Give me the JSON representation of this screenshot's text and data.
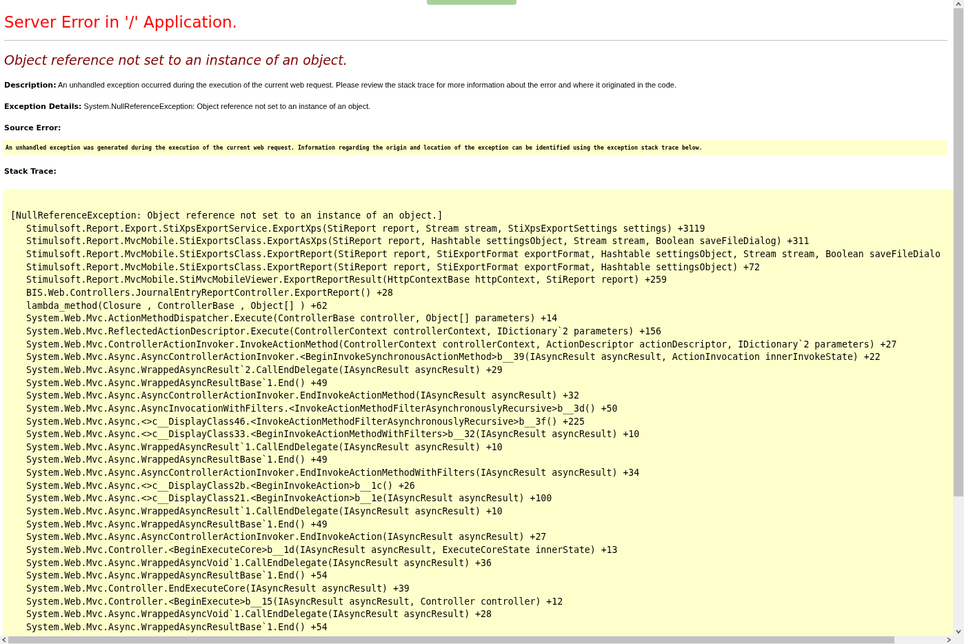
{
  "title": "Server Error in '/' Application.",
  "error_message": "Object reference not set to an instance of an object.",
  "description": "**Description:** An unhandled exception occurred during the execution of the current web request. Please review the stack trace for more information about the error and where it originated in the code.",
  "exception_details": "**Exception Details:** System.NullReferenceException: Object reference not set to an instance of an object.",
  "source_error": {
    "label": "Source Error:",
    "text": "An unhandled exception was generated during the execution of the current web request. Information regarding the origin and location of the exception can be identified using the exception stack trace below."
  },
  "stack_trace": {
    "label": "Stack Trace:",
    "header": "[NullReferenceException: Object reference not set to an instance of an object.]",
    "frames": [
      "Stimulsoft.Report.Export.StiXpsExportService.ExportXps(StiReport report, Stream stream, StiXpsExportSettings settings) +3119",
      "Stimulsoft.Report.MvcMobile.StiExportsClass.ExportAsXps(StiReport report, Hashtable settingsObject, Stream stream, Boolean saveFileDialog) +311",
      "Stimulsoft.Report.MvcMobile.StiExportsClass.ExportReport(StiReport report, StiExportFormat exportFormat, Hashtable settingsObject, Stream stream, Boolean saveFileDialo",
      "Stimulsoft.Report.MvcMobile.StiExportsClass.ExportReport(StiReport report, StiExportFormat exportFormat, Hashtable settingsObject) +72",
      "Stimulsoft.Report.MvcMobile.StiMvcMobileViewer.ExportReportResult(HttpContextBase httpContext, StiReport report) +259",
      "BIS.Web.Controllers.JournalEntryReportController.ExportReport() +28",
      "lambda_method(Closure , ControllerBase , Object[] ) +62",
      "System.Web.Mvc.ActionMethodDispatcher.Execute(ControllerBase controller, Object[] parameters) +14",
      "System.Web.Mvc.ReflectedActionDescriptor.Execute(ControllerContext controllerContext, IDictionary`2 parameters) +156",
      "System.Web.Mvc.ControllerActionInvoker.InvokeActionMethod(ControllerContext controllerContext, ActionDescriptor actionDescriptor, IDictionary`2 parameters) +27",
      "System.Web.Mvc.Async.AsyncControllerActionInvoker.<BeginInvokeSynchronousActionMethod>b__39(IAsyncResult asyncResult, ActionInvocation innerInvokeState) +22",
      "System.Web.Mvc.Async.WrappedAsyncResult`2.CallEndDelegate(IAsyncResult asyncResult) +29",
      "System.Web.Mvc.Async.WrappedAsyncResultBase`1.End() +49",
      "System.Web.Mvc.Async.AsyncControllerActionInvoker.EndInvokeActionMethod(IAsyncResult asyncResult) +32",
      "System.Web.Mvc.Async.AsyncInvocationWithFilters.<InvokeActionMethodFilterAsynchronouslyRecursive>b__3d() +50",
      "System.Web.Mvc.Async.<>c__DisplayClass46.<InvokeActionMethodFilterAsynchronouslyRecursive>b__3f() +225",
      "System.Web.Mvc.Async.<>c__DisplayClass33.<BeginInvokeActionMethodWithFilters>b__32(IAsyncResult asyncResult) +10",
      "System.Web.Mvc.Async.WrappedAsyncResult`1.CallEndDelegate(IAsyncResult asyncResult) +10",
      "System.Web.Mvc.Async.WrappedAsyncResultBase`1.End() +49",
      "System.Web.Mvc.Async.AsyncControllerActionInvoker.EndInvokeActionMethodWithFilters(IAsyncResult asyncResult) +34",
      "System.Web.Mvc.Async.<>c__DisplayClass2b.<BeginInvokeAction>b__1c() +26",
      "System.Web.Mvc.Async.<>c__DisplayClass21.<BeginInvokeAction>b__1e(IAsyncResult asyncResult) +100",
      "System.Web.Mvc.Async.WrappedAsyncResult`1.CallEndDelegate(IAsyncResult asyncResult) +10",
      "System.Web.Mvc.Async.WrappedAsyncResultBase`1.End() +49",
      "System.Web.Mvc.Async.AsyncControllerActionInvoker.EndInvokeAction(IAsyncResult asyncResult) +27",
      "System.Web.Mvc.Controller.<BeginExecuteCore>b__1d(IAsyncResult asyncResult, ExecuteCoreState innerState) +13",
      "System.Web.Mvc.Async.WrappedAsyncVoid`1.CallEndDelegate(IAsyncResult asyncResult) +36",
      "System.Web.Mvc.Async.WrappedAsyncResultBase`1.End() +54",
      "System.Web.Mvc.Controller.EndExecuteCore(IAsyncResult asyncResult) +39",
      "System.Web.Mvc.Controller.<BeginExecute>b__15(IAsyncResult asyncResult, Controller controller) +12",
      "System.Web.Mvc.Async.WrappedAsyncVoid`1.CallEndDelegate(IAsyncResult asyncResult) +28",
      "System.Web.Mvc.Async.WrappedAsyncResultBase`1.End() +54"
    ]
  }
}
